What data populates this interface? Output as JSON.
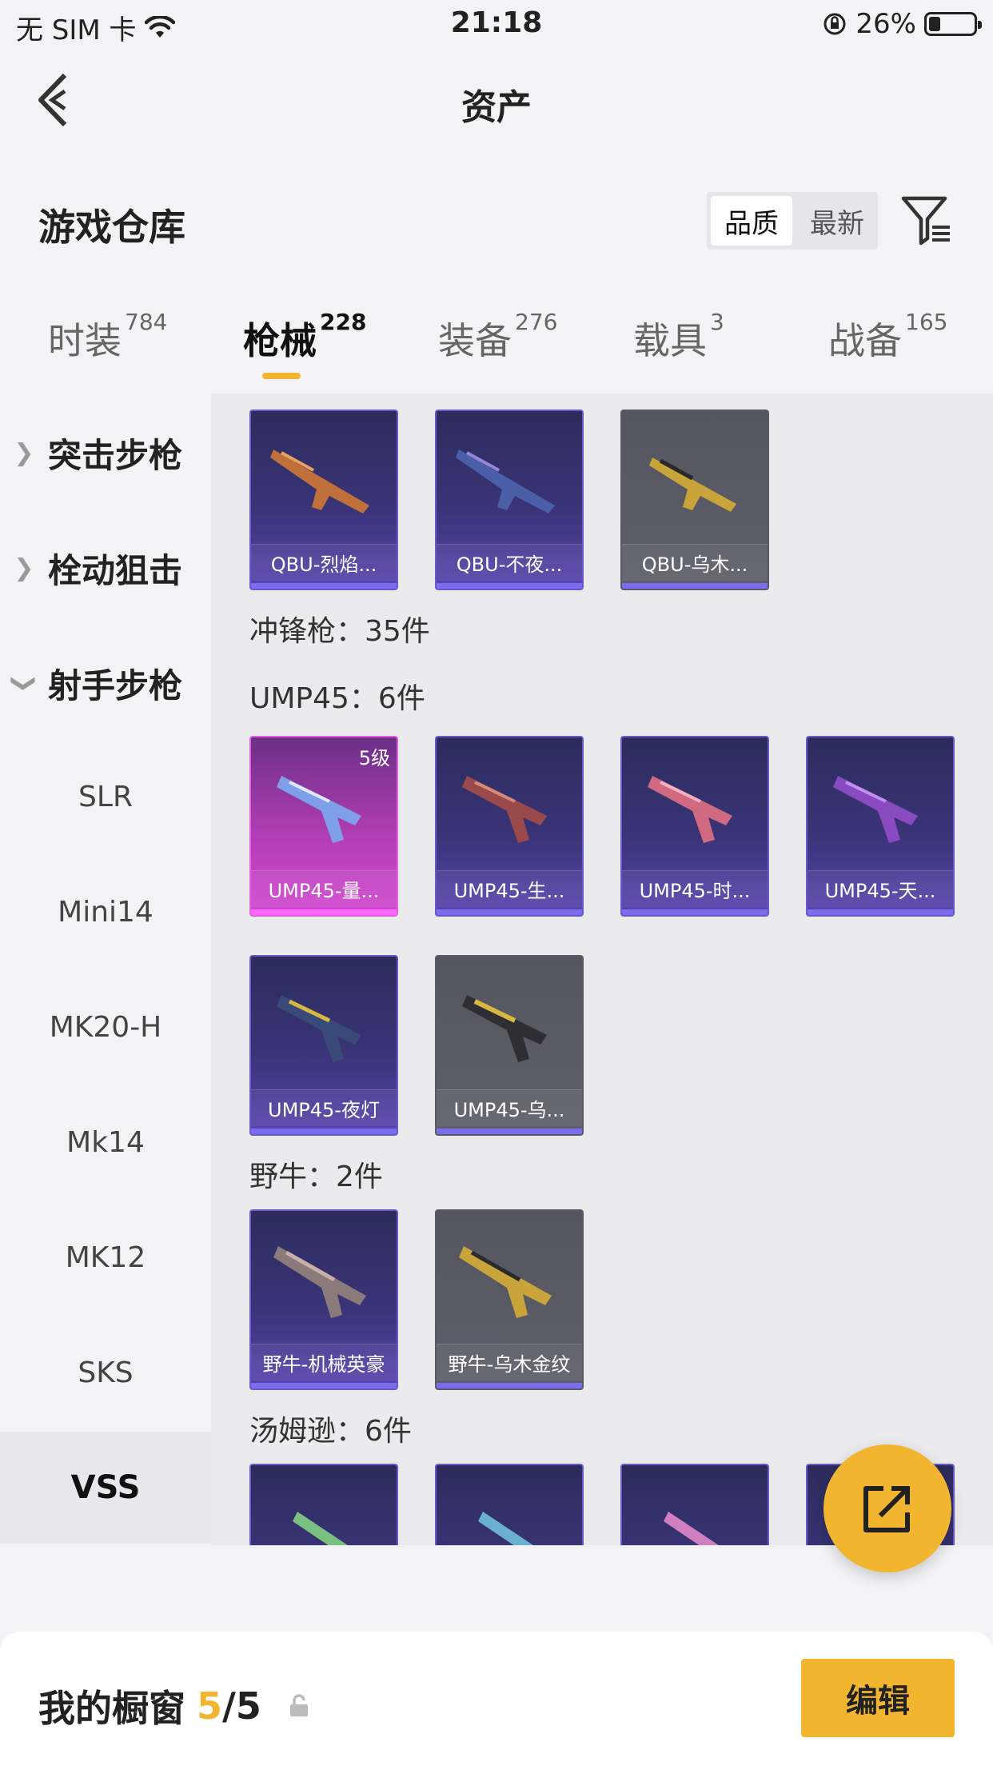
{
  "status_bar": {
    "carrier": "无 SIM 卡",
    "time": "21:18",
    "battery": "26%",
    "battery_level": 0.26
  },
  "nav": {
    "title": "资产"
  },
  "header": {
    "title": "游戏仓库",
    "sort_options": [
      "品质",
      "最新"
    ],
    "sort_selected": "品质"
  },
  "tabs": [
    {
      "label": "时装",
      "count": "784"
    },
    {
      "label": "枪械",
      "count": "228"
    },
    {
      "label": "装备",
      "count": "276"
    },
    {
      "label": "载具",
      "count": "3"
    },
    {
      "label": "战备",
      "count": "165"
    }
  ],
  "sidebar": {
    "groups": [
      "突击步枪",
      "栓动狙击",
      "射手步枪"
    ],
    "subitems": [
      "SLR",
      "Mini14",
      "MK20-H",
      "Mk14",
      "MK12",
      "SKS",
      "VSS"
    ]
  },
  "content": {
    "qbu_cards": [
      "QBU-烈焰...",
      "QBU-不夜...",
      "QBU-乌木..."
    ],
    "smg_label": "冲锋枪：35件",
    "ump_label": "UMP45：6件",
    "ump_cards": [
      "UMP45-量...",
      "UMP45-生...",
      "UMP45-时...",
      "UMP45-天...",
      "UMP45-夜灯",
      "UMP45-乌..."
    ],
    "ump_level": "5级",
    "bison_label": "野牛：2件",
    "bison_cards": [
      "野牛-机械英豪",
      "野牛-乌木金纹"
    ],
    "tommy_label": "汤姆逊：6件"
  },
  "bottom": {
    "showcase_label": "我的橱窗",
    "showcase_count": "5",
    "showcase_total": "/5",
    "edit_label": "编辑"
  },
  "colors": {
    "accent": "#f2b530",
    "card_purple": "#3a3478",
    "card_gray": "#5f5f6b",
    "card_pink": "#b73fb8"
  }
}
